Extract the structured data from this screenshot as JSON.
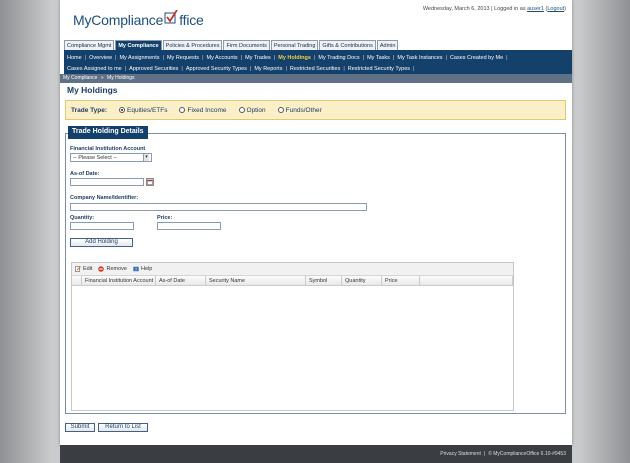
{
  "header": {
    "logo_text_left": "MyCompliance",
    "logo_text_right": "ffice",
    "date_text": "Wednesday, March 6, 2013",
    "login_prefix": "| Logged in as",
    "user": "auser1",
    "logout": "Logout"
  },
  "top_tabs": [
    {
      "label": "Compliance Mgmt",
      "active": false
    },
    {
      "label": "My Compliance",
      "active": true
    },
    {
      "label": "Policies & Procedures",
      "active": false
    },
    {
      "label": "Firm Documents",
      "active": false
    },
    {
      "label": "Personal Trading",
      "active": false
    },
    {
      "label": "Gifts & Contributions",
      "active": false
    },
    {
      "label": "Admin",
      "active": false
    }
  ],
  "nav_row1": [
    {
      "label": "Home"
    },
    {
      "label": "Overview"
    },
    {
      "label": "My Assignments"
    },
    {
      "label": "My Requests"
    },
    {
      "label": "My Accounts"
    },
    {
      "label": "My Trades"
    },
    {
      "label": "My Holdings",
      "active": true
    },
    {
      "label": "My Trading Docs"
    },
    {
      "label": "My Tasks"
    },
    {
      "label": "My Task Instances"
    },
    {
      "label": "Cases Created by Me"
    }
  ],
  "nav_row2": [
    {
      "label": "Cases Assigned to me"
    },
    {
      "label": "Approved Securities"
    },
    {
      "label": "Approved Security Types"
    },
    {
      "label": "My Reports"
    },
    {
      "label": "Restricted Securities"
    },
    {
      "label": "Restricted Security Types"
    }
  ],
  "breadcrumb": {
    "root": "My Compliance",
    "sep": "»",
    "current": "My Holdings"
  },
  "page_title": "My Holdings",
  "trade_type": {
    "label": "Trade Type:",
    "options": [
      {
        "label": "Equities/ETFs",
        "selected": true
      },
      {
        "label": "Fixed Income",
        "selected": false
      },
      {
        "label": "Option",
        "selected": false
      },
      {
        "label": "Funds/Other",
        "selected": false
      }
    ]
  },
  "form": {
    "legend": "Trade Holding Details",
    "fi_account_label": "Financial Institution Account",
    "fi_account_value": "-- Please Select --",
    "asof_label": "As-of Date:",
    "company_label": "Company Name/Identifier:",
    "quantity_label": "Quantity:",
    "price_label": "Price:",
    "add_button": "Add Holding"
  },
  "grid": {
    "toolbar": {
      "edit": "Edit",
      "remove": "Remove",
      "help": "Help"
    },
    "columns": [
      "",
      "Financial Institution Account",
      "As-of Date",
      "Security Name",
      "Symbol",
      "Quantity",
      "Price",
      ""
    ]
  },
  "actions": {
    "submit": "Submit",
    "return": "Return to List"
  },
  "footer": {
    "privacy": "Privacy Statement",
    "copyright": "© MyComplianceOffice 6.10-#9453"
  },
  "colors": {
    "nav": "#14406c",
    "accent": "#f4d03f",
    "logo_check": "#c0392b"
  }
}
